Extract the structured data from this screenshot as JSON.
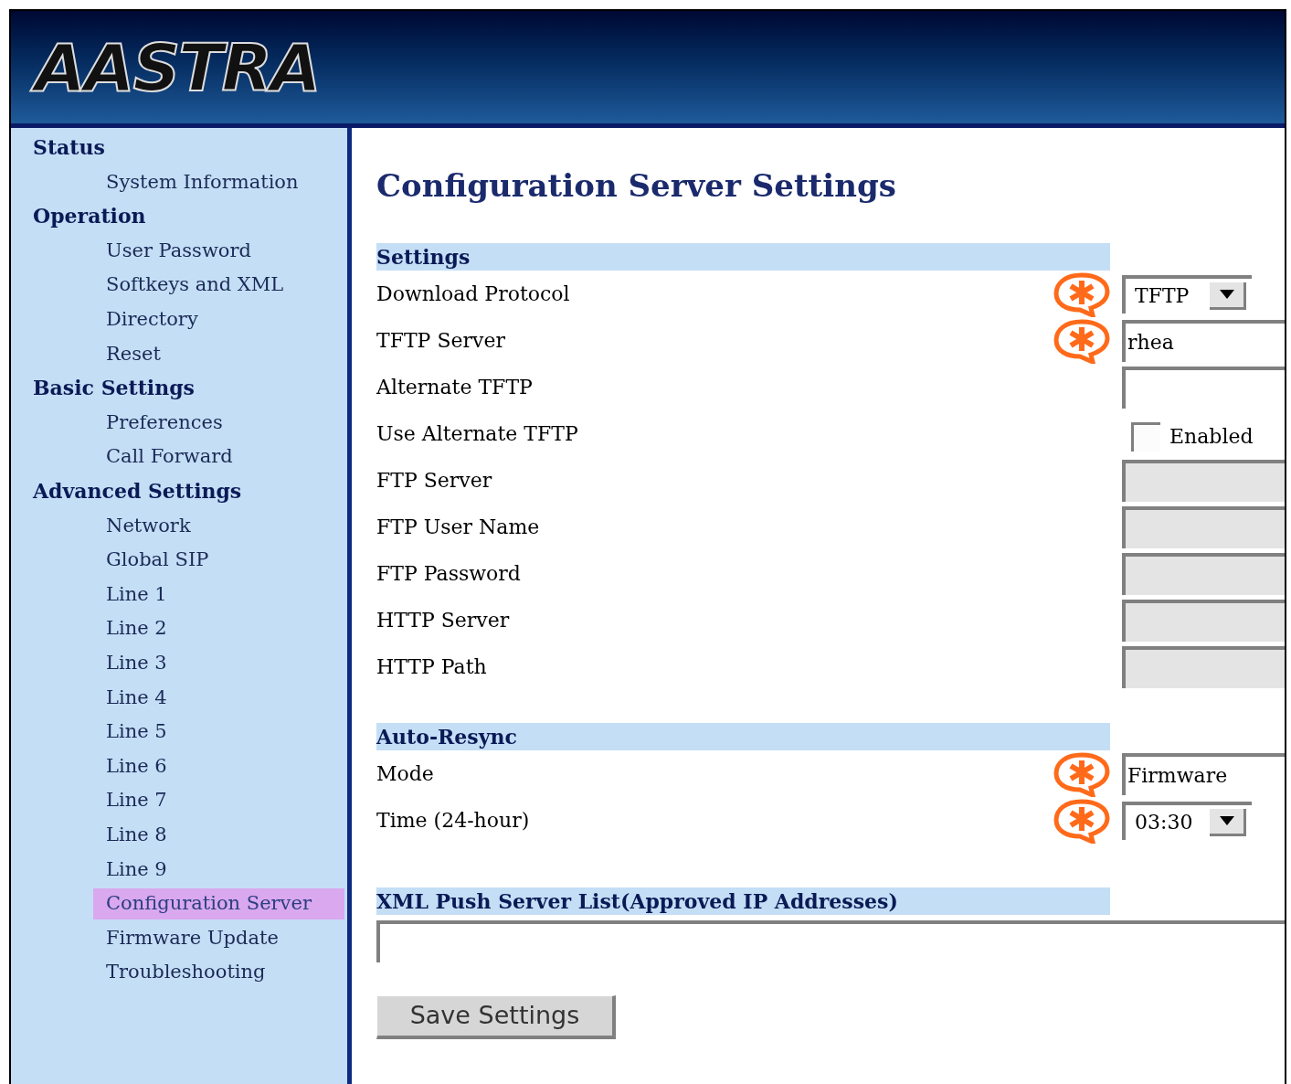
{
  "header": {
    "logo": "AASTRA"
  },
  "sidebar": {
    "groups": [
      {
        "heading": "Status",
        "items": [
          {
            "label": "System Information",
            "selected": false
          }
        ]
      },
      {
        "heading": "Operation",
        "items": [
          {
            "label": "User Password",
            "selected": false
          },
          {
            "label": "Softkeys and XML",
            "selected": false
          },
          {
            "label": "Directory",
            "selected": false
          },
          {
            "label": "Reset",
            "selected": false
          }
        ]
      },
      {
        "heading": "Basic Settings",
        "items": [
          {
            "label": "Preferences",
            "selected": false
          },
          {
            "label": "Call Forward",
            "selected": false
          }
        ]
      },
      {
        "heading": "Advanced Settings",
        "items": [
          {
            "label": "Network",
            "selected": false
          },
          {
            "label": "Global SIP",
            "selected": false
          },
          {
            "label": "Line 1",
            "selected": false
          },
          {
            "label": "Line 2",
            "selected": false
          },
          {
            "label": "Line 3",
            "selected": false
          },
          {
            "label": "Line 4",
            "selected": false
          },
          {
            "label": "Line 5",
            "selected": false
          },
          {
            "label": "Line 6",
            "selected": false
          },
          {
            "label": "Line 7",
            "selected": false
          },
          {
            "label": "Line 8",
            "selected": false
          },
          {
            "label": "Line 9",
            "selected": false
          },
          {
            "label": "Configuration Server",
            "selected": true
          },
          {
            "label": "Firmware Update",
            "selected": false
          },
          {
            "label": "Troubleshooting",
            "selected": false
          }
        ]
      }
    ]
  },
  "page_title": "Configuration Server Settings",
  "sections": [
    {
      "title": "Settings",
      "fields": [
        {
          "label": "Download Protocol",
          "kind": "select",
          "required": true,
          "value": "TFTP"
        },
        {
          "label": "TFTP Server",
          "kind": "text",
          "required": true,
          "disabled": false,
          "value": "rhea"
        },
        {
          "label": "Alternate TFTP",
          "kind": "text",
          "required": false,
          "disabled": false
        },
        {
          "label": "Use Alternate TFTP",
          "kind": "checkbox",
          "required": false,
          "checked": false,
          "option": "Enabled"
        },
        {
          "label": "FTP Server",
          "kind": "text",
          "required": false,
          "disabled": true
        },
        {
          "label": "FTP User Name",
          "kind": "text",
          "required": false,
          "disabled": true
        },
        {
          "label": "FTP Password",
          "kind": "text",
          "required": false,
          "disabled": true
        },
        {
          "label": "HTTP Server",
          "kind": "text",
          "required": false,
          "disabled": true
        },
        {
          "label": "HTTP Path",
          "kind": "text",
          "required": false,
          "disabled": true
        }
      ]
    },
    {
      "title": "Auto-Resync",
      "fields": [
        {
          "label": "Mode",
          "kind": "text",
          "required": true,
          "disabled": false,
          "value": "Firmware"
        },
        {
          "label": "Time (24-hour)",
          "kind": "select",
          "required": true,
          "value": "03:30"
        }
      ]
    }
  ],
  "xml_push": {
    "title": "XML Push Server List(Approved IP Addresses)"
  },
  "save_button": "Save Settings"
}
